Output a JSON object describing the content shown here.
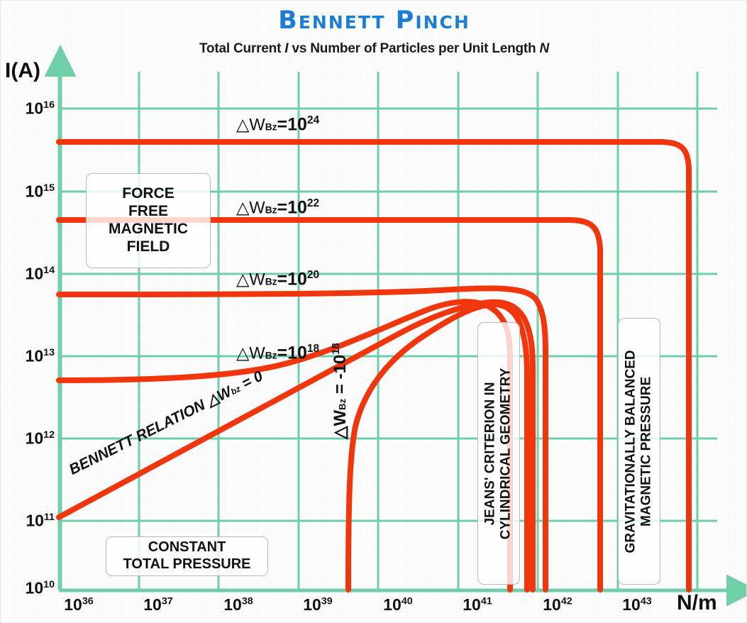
{
  "header": {
    "title": "Bennett Pinch",
    "subtitle_pre": "Total Current ",
    "subtitle_i": "I",
    "subtitle_mid": " vs Number of Particles per Unit Length ",
    "subtitle_n": "N"
  },
  "axes": {
    "ylabel": "I(A)",
    "xlabel": "N/m",
    "yticks": [
      "10",
      "10",
      "10",
      "10",
      "10",
      "10",
      "10"
    ],
    "yexps": [
      "16",
      "15",
      "14",
      "13",
      "12",
      "11",
      "10"
    ],
    "xticks": [
      "10",
      "10",
      "10",
      "10",
      "10",
      "10",
      "10",
      "10"
    ],
    "xexps": [
      "36",
      "37",
      "38",
      "39",
      "40",
      "41",
      "42",
      "43"
    ]
  },
  "boxes": {
    "force_free": "FORCE FREE MAGNETIC FIELD",
    "force_free_lines": [
      "FORCE",
      "FREE",
      "MAGNETIC",
      "FIELD"
    ],
    "constant_pressure_lines": [
      "CONSTANT",
      "TOTAL PRESSURE"
    ],
    "jeans_line1": "JEANS' CRITERION IN",
    "jeans_line2": "CYLINDRICAL GEOMETRY",
    "grav_line1": "GRAVITATIONALLY BALANCED",
    "grav_line2": "MAGNETIC PRESSURE"
  },
  "curve_labels": {
    "dw24_pre": "△W",
    "dw24_sub": "Bz",
    "dw24_eq": "=10",
    "dw24_exp": "24",
    "dw22_exp": "22",
    "dw20_exp": "20",
    "dw18_exp": "18",
    "bennett_pre": "BENNETT RELATION △W",
    "bennett_sub": "bz",
    "bennett_post": " = 0",
    "neg_pre": "△W",
    "neg_sub": "Bz",
    "neg_eq": " = -10",
    "neg_exp": "18"
  },
  "colors": {
    "title": "#1a7fd4",
    "grid": "#6ecfa8",
    "curve": "#f1360d",
    "text": "#111111",
    "background": "#fefefe"
  },
  "chart_data": {
    "type": "line",
    "title": "Bennett Pinch",
    "subtitle": "Total Current I vs Number of Particles per Unit Length N",
    "xlabel": "N/m",
    "ylabel": "I(A)",
    "xscale": "log",
    "yscale": "log",
    "xlim": [
      1e+36,
      1.6e+43
    ],
    "ylim": [
      10000000000.0,
      2.2e+16
    ],
    "xtick_values": [
      1e+36,
      1e+37,
      1e+38,
      1e+39,
      1e+40,
      1e+41,
      1e+42,
      1e+43
    ],
    "ytick_values": [
      10000000000.0,
      100000000000.0,
      1000000000000.0,
      10000000000000.0,
      100000000000000.0,
      1000000000000000.0,
      1e+16
    ],
    "grid": true,
    "legend": "none (inline curve labels)",
    "series": [
      {
        "name": "ΔW_Bz = 10^24",
        "plateau_current": 4000000000000000.0,
        "cutoff_N": 4e+43,
        "points": [
          [
            1e+36,
            4000000000000000.0
          ],
          [
            1e+43,
            4000000000000000.0
          ],
          [
            3.2e+43,
            3900000000000000.0
          ],
          [
            4e+43,
            1200000000000000.0
          ],
          [
            4.1e+43,
            10000000000.0
          ]
        ]
      },
      {
        "name": "ΔW_Bz = 10^22",
        "plateau_current": 400000000000000.0,
        "cutoff_N": 6e+42,
        "points": [
          [
            1e+36,
            400000000000000.0
          ],
          [
            2e+42,
            400000000000000.0
          ],
          [
            5e+42,
            380000000000000.0
          ],
          [
            6e+42,
            100000000000000.0
          ],
          [
            6.1e+42,
            10000000000.0
          ]
        ]
      },
      {
        "name": "ΔW_Bz = 10^20",
        "plateau_current": 50000000000000.0,
        "cutoff_N": 1.2e+42,
        "points": [
          [
            1e+36,
            50000000000000.0
          ],
          [
            1e+41,
            51000000000000.0
          ],
          [
            4e+41,
            62000000000000.0
          ],
          [
            8e+41,
            63000000000000.0
          ],
          [
            1.1e+42,
            20000000000000.0
          ],
          [
            1.2e+42,
            10000000000.0
          ]
        ]
      },
      {
        "name": "ΔW_Bz = 10^18",
        "plateau_current": 4000000000000.0,
        "cutoff_N": 1.05e+42,
        "points": [
          [
            1e+36,
            4000000000000.0
          ],
          [
            1e+40,
            5500000000000.0
          ],
          [
            1e+41,
            20000000000000.0
          ],
          [
            4e+41,
            36000000000000.0
          ],
          [
            7e+41,
            35000000000000.0
          ],
          [
            1e+42,
            8000000000000.0
          ],
          [
            1.05e+42,
            10000000000.0
          ]
        ]
      },
      {
        "name": "Bennett relation ΔW_bz = 0",
        "type": "diagonal",
        "points": [
          [
            1e+36,
            65000000000.0
          ],
          [
            1e+41,
            20000000000000.0
          ],
          [
            4e+41,
            35000000000000.0
          ],
          [
            8.5e+41,
            33000000000000.0
          ],
          [
            9.6e+41,
            10000000000.0
          ]
        ]
      },
      {
        "name": "ΔW_Bz = -10^18",
        "cutoff_N": 3.5e+39,
        "points": [
          [
            3.5e+39,
            10000000000.0
          ],
          [
            3.8e+39,
            3000000000000.0
          ],
          [
            1e+40,
            7000000000000.0
          ],
          [
            1e+41,
            20000000000000.0
          ],
          [
            4e+41,
            35000000000000.0
          ],
          [
            8e+41,
            34000000000000.0
          ],
          [
            9.4e+41,
            10000000000.0
          ]
        ]
      }
    ],
    "annotations": [
      "FORCE FREE MAGNETIC FIELD",
      "CONSTANT TOTAL PRESSURE",
      "JEANS' CRITERION IN CYLINDRICAL GEOMETRY",
      "GRAVITATIONALLY BALANCED MAGNETIC PRESSURE"
    ]
  }
}
